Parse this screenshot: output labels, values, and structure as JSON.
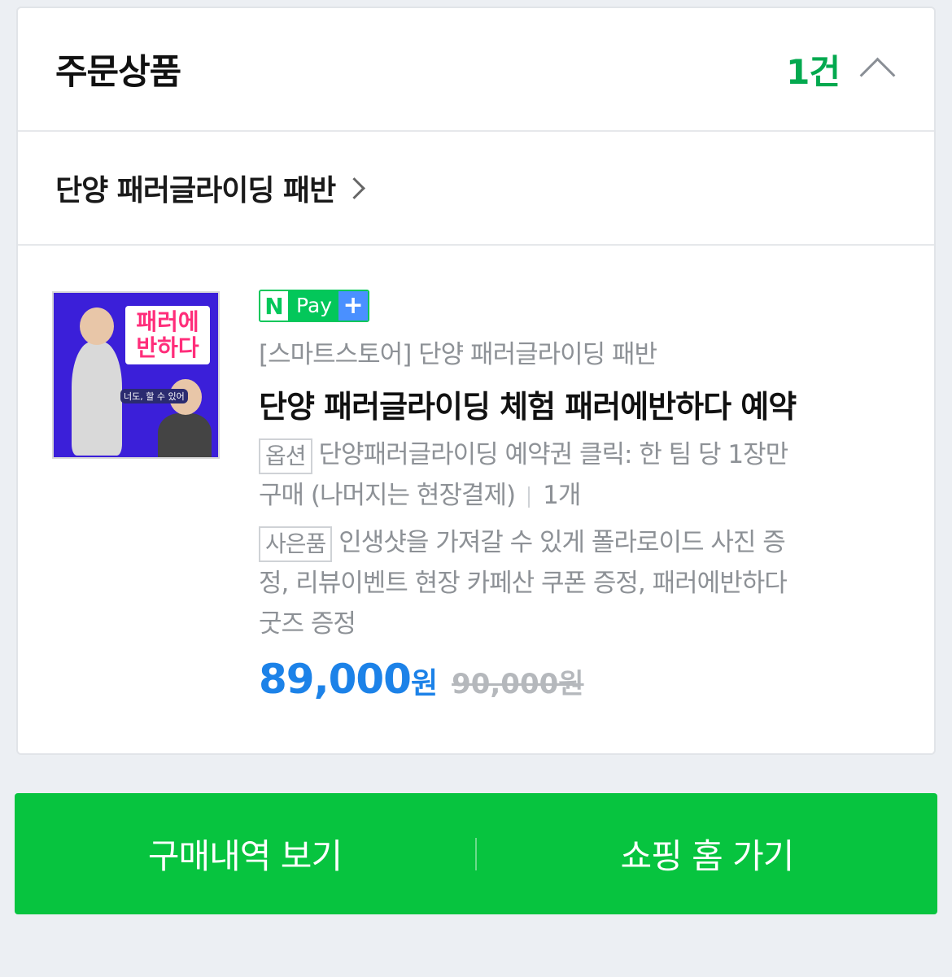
{
  "header": {
    "title": "주문상품",
    "count": "1건"
  },
  "store": {
    "name": "단양 패러글라이딩 패반"
  },
  "item": {
    "thumbnail_text": "패러에 반하다",
    "thumbnail_caption": "너도, 할 수 있어",
    "npay": {
      "n": "N",
      "pay": "Pay",
      "plus": "+"
    },
    "seller_line": "[스마트스토어] 단양 패러글라이딩 패반",
    "product_name": "단양 패러글라이딩 체험 패러에반하다 예약",
    "option": {
      "tag": "옵션",
      "text1": "단양패러글라이딩 예약권 클릭: 한 팀 당 1장만",
      "text2": "구매 (나머지는 현장결제)",
      "quantity": "1개"
    },
    "gift": {
      "tag": "사은품",
      "text1": "인생샷을 가져갈 수 있게 폴라로이드 사진 증",
      "text2": "정, 리뷰이벤트 현장 카페산 쿠폰 증정, 패러에반하다",
      "text3": "굿즈 증정"
    },
    "price": "89,000",
    "price_unit": "원",
    "original_price": "90,000원"
  },
  "actions": {
    "history": "구매내역 보기",
    "home": "쇼핑 홈 가기"
  },
  "colors": {
    "accent_green": "#03a94f",
    "button_green": "#07c43f",
    "price_blue": "#1c82e8"
  }
}
